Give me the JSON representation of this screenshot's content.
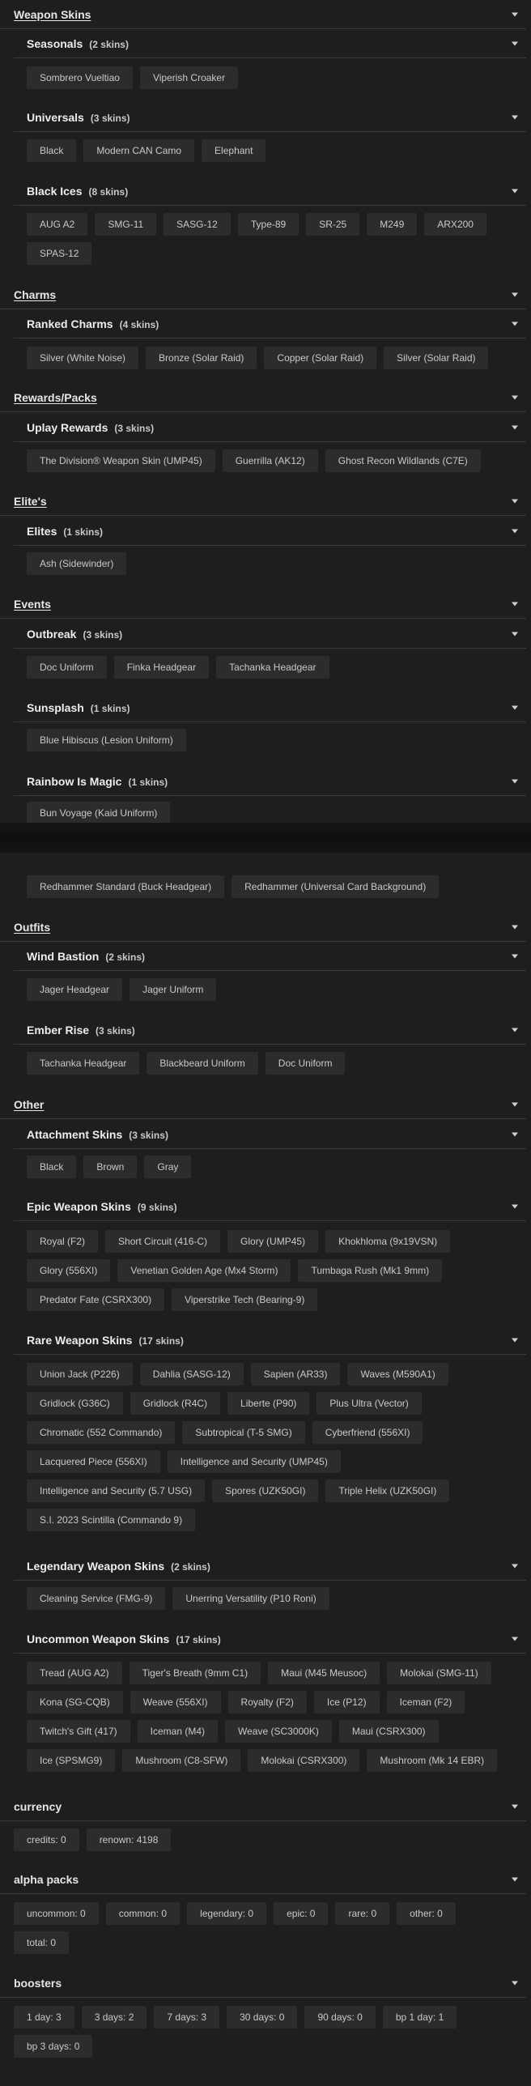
{
  "top": {
    "weapon_skins": {
      "title": "Weapon Skins",
      "seasonals": {
        "title": "Seasonals",
        "count": "(2 skins)",
        "items": [
          "Sombrero Vueltiao",
          "Viperish Croaker"
        ]
      },
      "universals": {
        "title": "Universals",
        "count": "(3 skins)",
        "items": [
          "Black",
          "Modern CAN Camo",
          "Elephant"
        ]
      },
      "black_ices": {
        "title": "Black Ices",
        "count": "(8 skins)",
        "items": [
          "AUG A2",
          "SMG-11",
          "SASG-12",
          "Type-89",
          "SR-25",
          "M249",
          "ARX200",
          "SPAS-12"
        ]
      }
    },
    "charms": {
      "title": "Charms",
      "ranked": {
        "title": "Ranked Charms",
        "count": "(4 skins)",
        "items": [
          "Silver (White Noise)",
          "Bronze (Solar Raid)",
          "Copper (Solar Raid)",
          "Silver (Solar Raid)"
        ]
      }
    },
    "rewards": {
      "title": "Rewards/Packs",
      "uplay": {
        "title": "Uplay Rewards",
        "count": "(3 skins)",
        "items": [
          "The Division® Weapon Skin (UMP45)",
          "Guerrilla (AK12)",
          "Ghost Recon Wildlands (C7E)"
        ]
      }
    },
    "elites_section": {
      "title": "Elite's",
      "elites": {
        "title": "Elites",
        "count": "(1 skins)",
        "items": [
          "Ash (Sidewinder)"
        ]
      }
    },
    "events": {
      "title": "Events",
      "outbreak": {
        "title": "Outbreak",
        "count": "(3 skins)",
        "items": [
          "Doc Uniform",
          "Finka Headgear",
          "Tachanka Headgear"
        ]
      },
      "sunsplash": {
        "title": "Sunsplash",
        "count": "(1 skins)",
        "items": [
          "Blue Hibiscus (Lesion Uniform)"
        ]
      },
      "rainbow": {
        "title": "Rainbow Is Magic",
        "count": "(1 skins)",
        "items": [
          "Bun Voyage (Kaid Uniform)"
        ]
      }
    }
  },
  "bottom": {
    "redhammer": {
      "items": [
        "Redhammer Standard (Buck Headgear)",
        "Redhammer (Universal Card Background)"
      ]
    },
    "outfits": {
      "title": "Outfits",
      "wind_bastion": {
        "title": "Wind Bastion",
        "count": "(2 skins)",
        "items": [
          "Jager Headgear",
          "Jager Uniform"
        ]
      },
      "ember_rise": {
        "title": "Ember Rise",
        "count": "(3 skins)",
        "items": [
          "Tachanka Headgear",
          "Blackbeard Uniform",
          "Doc Uniform"
        ]
      }
    },
    "other": {
      "title": "Other",
      "attachment": {
        "title": "Attachment Skins",
        "count": "(3 skins)",
        "items": [
          "Black",
          "Brown",
          "Gray"
        ]
      },
      "epic": {
        "title": "Epic Weapon Skins",
        "count": "(9 skins)",
        "items": [
          "Royal (F2)",
          "Short Circuit (416-C)",
          "Glory (UMP45)",
          "Khokhloma (9x19VSN)",
          "Glory (556XI)",
          "Venetian Golden Age (Mx4 Storm)",
          "Tumbaga Rush (Mk1 9mm)",
          "Predator Fate (CSRX300)",
          "Viperstrike Tech (Bearing-9)"
        ]
      },
      "rare": {
        "title": "Rare Weapon Skins",
        "count": "(17 skins)",
        "items": [
          "Union Jack (P226)",
          "Dahlia (SASG-12)",
          "Sapien (AR33)",
          "Waves (M590A1)",
          "Gridlock (G36C)",
          "Gridlock (R4C)",
          "Liberte (P90)",
          "Plus Ultra (Vector)",
          "Chromatic (552 Commando)",
          "Subtropical (T-5 SMG)",
          "Cyberfriend (556XI)",
          "Lacquered Piece (556XI)",
          "Intelligence and Security (UMP45)",
          "Intelligence and Security (5.7 USG)",
          "Spores (UZK50GI)",
          "Triple Helix (UZK50GI)",
          "S.I. 2023 Scintilla (Commando 9)"
        ]
      },
      "legendary": {
        "title": "Legendary Weapon Skins",
        "count": "(2 skins)",
        "items": [
          "Cleaning Service (FMG-9)",
          "Unerring Versatility (P10 Roni)"
        ]
      },
      "uncommon": {
        "title": "Uncommon Weapon Skins",
        "count": "(17 skins)",
        "items": [
          "Tread (AUG A2)",
          "Tiger's Breath (9mm C1)",
          "Maui (M45 Meusoc)",
          "Molokai (SMG-11)",
          "Kona (SG-CQB)",
          "Weave (556XI)",
          "Royalty (F2)",
          "Ice (P12)",
          "Iceman (F2)",
          "Twitch's Gift (417)",
          "Iceman (M4)",
          "Weave (SC3000K)",
          "Maui (CSRX300)",
          "Ice (SPSMG9)",
          "Mushroom (C8-SFW)",
          "Molokai (CSRX300)",
          "Mushroom (Mk 14 EBR)"
        ]
      }
    },
    "currency": {
      "title": "currency",
      "items": [
        "credits: 0",
        "renown: 4198"
      ]
    },
    "alpha_packs": {
      "title": "alpha packs",
      "items": [
        "uncommon: 0",
        "common: 0",
        "legendary: 0",
        "epic: 0",
        "rare: 0",
        "other: 0",
        "total: 0"
      ]
    },
    "boosters": {
      "title": "boosters",
      "items": [
        "1 day: 3",
        "3 days: 2",
        "7 days: 3",
        "30 days: 0",
        "90 days: 0",
        "bp 1 day: 1",
        "bp 3 days: 0"
      ]
    }
  }
}
